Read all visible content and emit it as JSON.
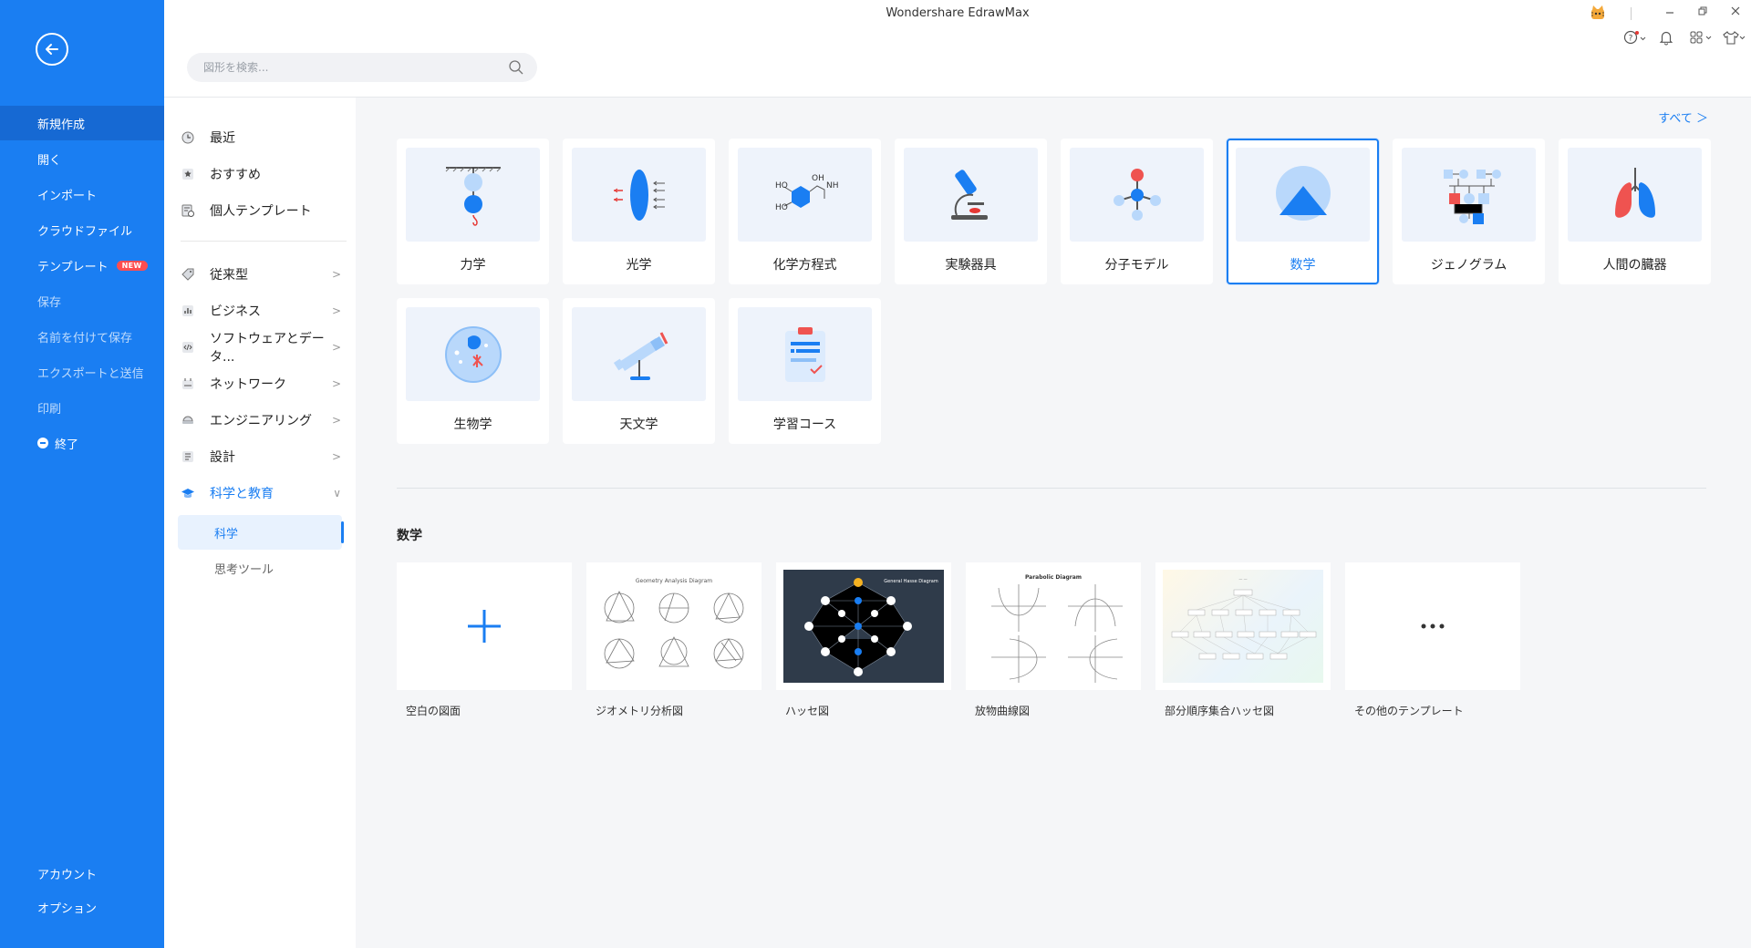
{
  "app": {
    "title": "Wondershare EdrawMax"
  },
  "nav": {
    "items": [
      {
        "label": "新規作成"
      },
      {
        "label": "開く"
      },
      {
        "label": "インポート"
      },
      {
        "label": "クラウドファイル"
      },
      {
        "label": "テンプレート",
        "badge": "NEW"
      },
      {
        "label": "保存"
      },
      {
        "label": "名前を付けて保存"
      },
      {
        "label": "エクスポートと送信"
      },
      {
        "label": "印刷"
      },
      {
        "label": "終了"
      }
    ],
    "bottom": [
      {
        "label": "アカウント"
      },
      {
        "label": "オプション"
      }
    ]
  },
  "search": {
    "placeholder": "図形を検索..."
  },
  "categories": {
    "quick": [
      {
        "label": "最近"
      },
      {
        "label": "おすすめ"
      },
      {
        "label": "個人テンプレート"
      }
    ],
    "groups": [
      {
        "label": "従来型"
      },
      {
        "label": "ビジネス"
      },
      {
        "label": "ソフトウェアとデータ..."
      },
      {
        "label": "ネットワーク"
      },
      {
        "label": "エンジニアリング"
      },
      {
        "label": "設計"
      },
      {
        "label": "科学と教育"
      }
    ],
    "sub": [
      {
        "label": "科学"
      },
      {
        "label": "思考ツール"
      }
    ]
  },
  "main": {
    "view_all": "すべて ＞",
    "tiles": [
      {
        "label": "力学"
      },
      {
        "label": "光学"
      },
      {
        "label": "化学方程式"
      },
      {
        "label": "実験器具"
      },
      {
        "label": "分子モデル"
      },
      {
        "label": "数学"
      },
      {
        "label": "ジェノグラム"
      },
      {
        "label": "人間の臓器"
      },
      {
        "label": "生物学"
      },
      {
        "label": "天文学"
      },
      {
        "label": "学習コース"
      }
    ],
    "selected_tile": "数学",
    "section_title": "数学",
    "templates": [
      {
        "label": "空白の図面"
      },
      {
        "label": "ジオメトリ分析図",
        "thumb_title": "Geometry Analysis Diagram"
      },
      {
        "label": "ハッセ図",
        "thumb_title": "General Hasse Diagram"
      },
      {
        "label": "放物曲線図",
        "thumb_title": "Parabolic Diagram"
      },
      {
        "label": "部分順序集合ハッセ図"
      },
      {
        "label": "その他のテンプレート"
      }
    ]
  },
  "colors": {
    "primary": "#1a7ef2",
    "sidebar": "#1a7ef2",
    "selected_nav": "#1669d3",
    "background": "#f5f6f8",
    "badge": "#ff4d4f"
  }
}
